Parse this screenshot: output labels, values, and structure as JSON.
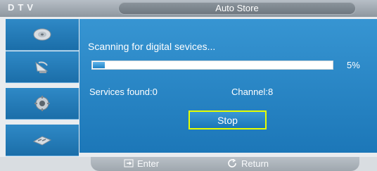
{
  "header": {
    "source_label": "DTV",
    "title": "Auto Store"
  },
  "sidebar": {
    "items": [
      {
        "icon": "disc-icon"
      },
      {
        "icon": "satellite-dish-icon"
      },
      {
        "icon": "gear-icon"
      },
      {
        "icon": "input-device-icon"
      }
    ]
  },
  "scan": {
    "status_text": "Scanning for digital sevices...",
    "progress_percent": 5,
    "progress_label": "5%",
    "services_found_label": "Services found:0",
    "channel_label": "Channel:8",
    "stop_label": "Stop"
  },
  "footer": {
    "enter_label": "Enter",
    "return_label": "Return",
    "enter_icon": "enter-icon",
    "return_icon": "return-icon"
  },
  "colors": {
    "panel_blue": "#2b87c6",
    "focus_yellow": "#e6ff00",
    "header_gray": "#8e979f"
  }
}
